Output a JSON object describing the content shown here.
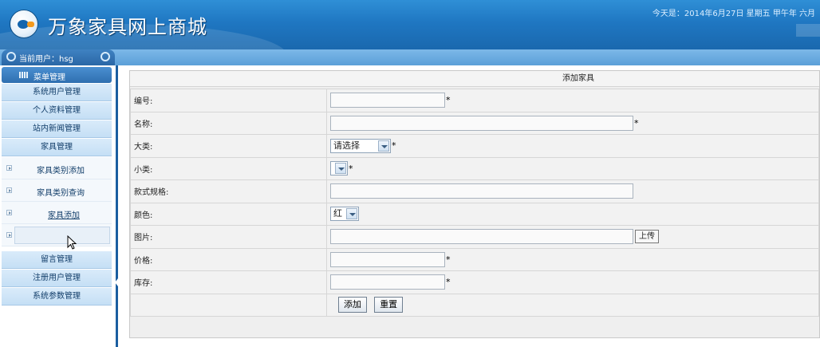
{
  "header": {
    "title": "万象家具网上商城",
    "date_line": "今天是：2014年6月27日 星期五 甲午年 六月"
  },
  "userbar": {
    "label": "当前用户：hsg"
  },
  "sidebar": {
    "menu_head": "菜单管理",
    "items": [
      {
        "label": "系统用户管理"
      },
      {
        "label": "个人资料管理"
      },
      {
        "label": "站内新闻管理"
      },
      {
        "label": "家具管理"
      }
    ],
    "sub_items": [
      {
        "label": "家具类别添加"
      },
      {
        "label": "家具类别查询"
      },
      {
        "label": "家具添加"
      },
      {
        "label": ""
      }
    ],
    "items_after": [
      {
        "label": "留言管理"
      },
      {
        "label": "注册用户管理"
      },
      {
        "label": "系统参数管理"
      }
    ]
  },
  "form": {
    "title": "添加家具",
    "fields": {
      "code": {
        "label": "编号:",
        "value": ""
      },
      "name": {
        "label": "名称:",
        "value": ""
      },
      "category": {
        "label": "大类:",
        "selected": "请选择"
      },
      "subcategory": {
        "label": "小类:",
        "selected": ""
      },
      "spec": {
        "label": "款式规格:",
        "value": ""
      },
      "color": {
        "label": "颜色:",
        "selected": "红"
      },
      "image": {
        "label": "图片:",
        "value": "",
        "upload_label": "上传"
      },
      "price": {
        "label": "价格:",
        "value": ""
      },
      "stock": {
        "label": "库存:",
        "value": ""
      }
    },
    "required_mark": "*",
    "buttons": {
      "submit": "添加",
      "reset": "重置"
    }
  }
}
